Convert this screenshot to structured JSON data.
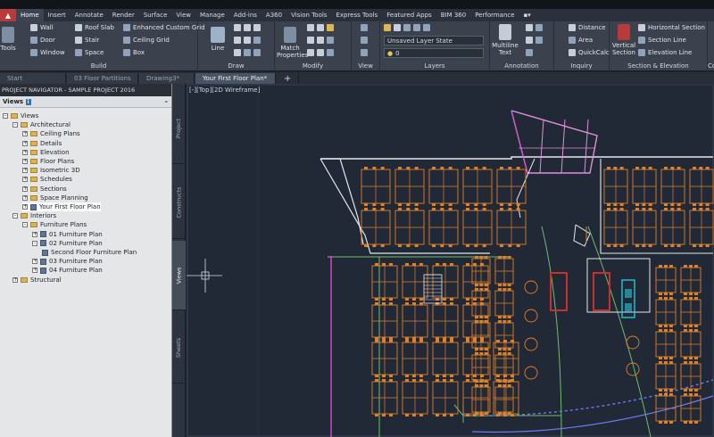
{
  "ribbon": {
    "tabs": [
      "Home",
      "Insert",
      "Annotate",
      "Render",
      "Surface",
      "View",
      "Manage",
      "Add-ins",
      "A360",
      "Vision Tools",
      "Express Tools",
      "Featured Apps",
      "BIM 360",
      "Performance"
    ],
    "active_tab": "Home",
    "build": {
      "tools": "Tools",
      "wall": "Wall",
      "door": "Door",
      "window": "Window",
      "roof_slab": "Roof Slab",
      "stair": "Stair",
      "space": "Space",
      "enhanced_custom_grid": "Enhanced Custom Grid",
      "ceiling_grid": "Ceiling Grid",
      "box": "Box",
      "label": "Build"
    },
    "draw": {
      "line": "Line",
      "label": "Draw"
    },
    "modify": {
      "match_properties": "Match Properties",
      "label": "Modify"
    },
    "view": {
      "label": "View"
    },
    "layers": {
      "state": "Unsaved Layer State",
      "current": "0",
      "label": "Layers"
    },
    "annotation": {
      "multiline_text": "Multiline Text",
      "label": "Annotation"
    },
    "inquiry": {
      "distance": "Distance",
      "area": "Area",
      "quickcalc": "QuickCalc",
      "label": "Inquiry"
    },
    "section": {
      "vertical_section": "Vertical Section",
      "horizontal_section": "Horizontal Section",
      "section_line": "Section Line",
      "elevation_line": "Elevation Line",
      "label": "Section & Elevation"
    },
    "extra": {
      "co": "Co"
    }
  },
  "file_tabs": [
    "Start",
    "03 Floor Partitions",
    "Drawing3*",
    "Your First Floor Plan*"
  ],
  "active_file_tab": "Your First Floor Plan*",
  "navigator": {
    "title": "PROJECT NAVIGATOR - SAMPLE PROJECT 2016",
    "header": "Views",
    "tree": [
      {
        "label": "Views",
        "level": 0,
        "toggle": "-",
        "type": "folder"
      },
      {
        "label": "Architectural",
        "level": 1,
        "toggle": "-",
        "type": "folder"
      },
      {
        "label": "Ceiling Plans",
        "level": 2,
        "toggle": "+",
        "type": "folder"
      },
      {
        "label": "Details",
        "level": 2,
        "toggle": "+",
        "type": "folder"
      },
      {
        "label": "Elevation",
        "level": 2,
        "toggle": "+",
        "type": "folder"
      },
      {
        "label": "Floor Plans",
        "level": 2,
        "toggle": "+",
        "type": "folder"
      },
      {
        "label": "Isometric 3D",
        "level": 2,
        "toggle": "+",
        "type": "folder"
      },
      {
        "label": "Schedules",
        "level": 2,
        "toggle": "+",
        "type": "folder"
      },
      {
        "label": "Sections",
        "level": 2,
        "toggle": "+",
        "type": "folder"
      },
      {
        "label": "Space Planning",
        "level": 2,
        "toggle": "+",
        "type": "folder"
      },
      {
        "label": "Your First Floor Plan",
        "level": 2,
        "toggle": "+",
        "type": "view",
        "selected": true
      },
      {
        "label": "Interiors",
        "level": 1,
        "toggle": "-",
        "type": "folder"
      },
      {
        "label": "Furniture Plans",
        "level": 2,
        "toggle": "-",
        "type": "folder"
      },
      {
        "label": "01 Furniture Plan",
        "level": 3,
        "toggle": "+",
        "type": "view"
      },
      {
        "label": "02 Furniture Plan",
        "level": 3,
        "toggle": "-",
        "type": "view"
      },
      {
        "label": "Second Floor Furniture Plan",
        "level": 4,
        "toggle": "",
        "type": "view"
      },
      {
        "label": "03 Furniture Plan",
        "level": 3,
        "toggle": "+",
        "type": "view"
      },
      {
        "label": "04 Furniture Plan",
        "level": 3,
        "toggle": "+",
        "type": "view"
      },
      {
        "label": "Structural",
        "level": 1,
        "toggle": "+",
        "type": "folder"
      }
    ],
    "side_tabs": [
      "Project",
      "Constructs",
      "Views",
      "Sheets"
    ],
    "active_side_tab": "Views"
  },
  "viewport": {
    "label": "[-][Top][2D Wireframe]"
  },
  "colors": {
    "wall": "#e6e8ec",
    "magenta": "#d64fc8",
    "orange": "#e0812a",
    "green": "#6fbf6a",
    "cyan": "#28c6d8",
    "red": "#c83030",
    "blue": "#6a7cf0"
  }
}
